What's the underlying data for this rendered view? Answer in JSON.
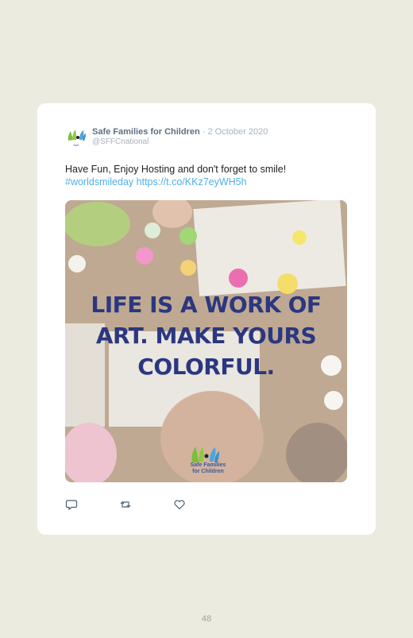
{
  "tweet": {
    "author_name": "Safe Families for Children",
    "separator": "·",
    "date": "2 October 2020",
    "handle": "@SFFCnational",
    "text": "Have Fun, Enjoy Hosting and don't forget to smile!",
    "hashtag": "#worldsmileday",
    "link": "https://t.co/KKz7eyWH5h"
  },
  "media": {
    "quote_lines": [
      "LIFE IS A WORK OF",
      "ART. MAKE YOURS",
      "COLORFUL."
    ],
    "logo_line1": "Safe Families",
    "logo_line2": "for Children"
  },
  "actions": {
    "reply": "reply-icon",
    "retweet": "retweet-icon",
    "like": "heart-icon"
  },
  "colors": {
    "background": "#ebebe0",
    "link": "#4fb0e6",
    "quote": "#2b3780"
  },
  "page": {
    "number": "48"
  }
}
